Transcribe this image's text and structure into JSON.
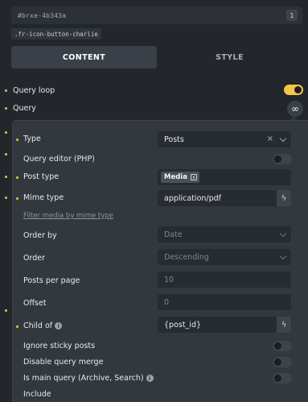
{
  "element": {
    "id": "#brxe-4b343a",
    "badge": "1",
    "class_chip": ".fr-icon-button-charlie"
  },
  "tabs": [
    {
      "label": "CONTENT",
      "active": true
    },
    {
      "label": "STYLE",
      "active": false
    }
  ],
  "controls": {
    "query_loop": {
      "label": "Query loop",
      "enabled": true
    },
    "query": {
      "label": "Query",
      "icon": "infinity-icon",
      "glyph": "∞"
    }
  },
  "query_popup": {
    "type": {
      "label": "Type",
      "value": "Posts",
      "clear": "×"
    },
    "query_editor": {
      "label": "Query editor (PHP)",
      "enabled": false
    },
    "post_type": {
      "label": "Post type",
      "tags": [
        "Media"
      ],
      "tag_remove": "x"
    },
    "mime_type": {
      "label": "Mime type",
      "value": "application/pdf",
      "hint": "Filter media by mime type"
    },
    "order_by": {
      "label": "Order by",
      "placeholder": "Date"
    },
    "order": {
      "label": "Order",
      "placeholder": "Descending"
    },
    "posts_per_page": {
      "label": "Posts per page",
      "placeholder": "10"
    },
    "offset": {
      "label": "Offset",
      "placeholder": "0"
    },
    "child_of": {
      "label": "Child of",
      "value": "{post_id}",
      "info": "i"
    },
    "ignore_sticky": {
      "label": "Ignore sticky posts",
      "enabled": false
    },
    "disable_merge": {
      "label": "Disable query merge",
      "enabled": false
    },
    "is_main_query": {
      "label": "Is main query (Archive, Search)",
      "info": "i",
      "enabled": false
    },
    "include": {
      "label": "Include"
    }
  },
  "icons": {
    "bolt": "ϟ",
    "chevron": "chevron-down-icon"
  },
  "colors": {
    "accent": "#f2c744",
    "bg": "#23272c",
    "popup": "#32383e"
  }
}
